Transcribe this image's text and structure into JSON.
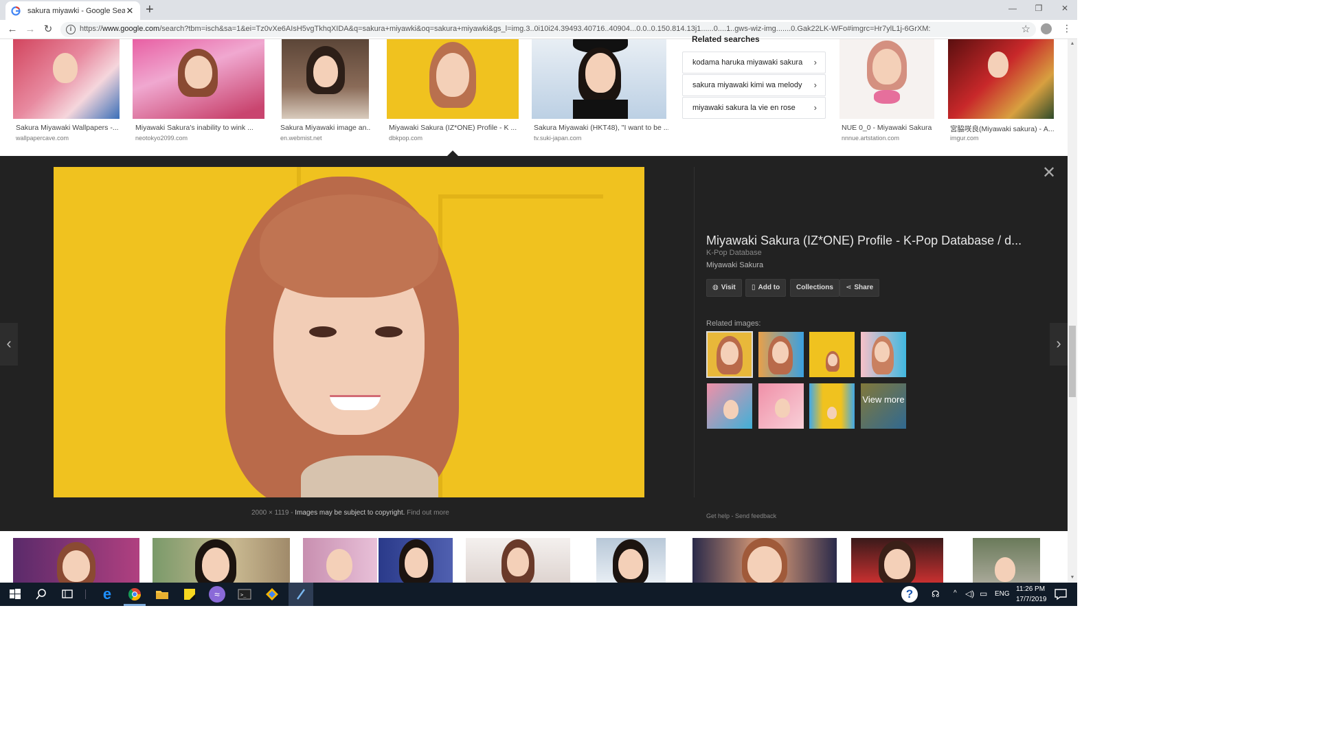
{
  "browser": {
    "tab_title": "sakura miyawki - Google Search",
    "url_prefix": "https://",
    "url_host": "www.google.com",
    "url_rest": "/search?tbm=isch&sa=1&ei=Tz0vXe6AIsH5vgTkhqXIDA&q=sakura+miyawki&oq=sakura+miyawki&gs_l=img.3..0i10i24.39493.40716..40904...0.0..0.150.814.13j1......0....1..gws-wiz-img.......0.Gak22LK-WFo#imgrc=Hr7ylL1j-6GrXM:"
  },
  "results_top": [
    {
      "caption": "Sakura Miyawaki Wallpapers -...",
      "domain": "wallpapercave.com"
    },
    {
      "caption": "Miyawaki Sakura's inability to wink ...",
      "domain": "neotokyo2099.com"
    },
    {
      "caption": "Sakura Miyawaki image an...",
      "domain": "en.webmist.net"
    },
    {
      "caption": "Miyawaki Sakura (IZ*ONE) Profile - K ...",
      "domain": "dbkpop.com"
    },
    {
      "caption": "Sakura Miyawaki (HKT48), \"I want to be ...",
      "domain": "tv.suki-japan.com"
    },
    {
      "caption": "NUE 0_0 - Miyawaki Sakura",
      "domain": "nnnue.artstation.com"
    },
    {
      "caption": "宮脇咲良(Miyawaki sakura) - A...",
      "domain": "imgur.com"
    }
  ],
  "related_searches": {
    "title": "Related searches",
    "items": [
      "kodama haruka miyawaki sakura",
      "sakura miyawaki kimi wa melody",
      "miyawaki sakura la vie en rose"
    ]
  },
  "preview": {
    "title": "Miyawaki Sakura (IZ*ONE) Profile - K-Pop Database / d...",
    "source": "K-Pop Database",
    "subtitle": "Miyawaki Sakura",
    "buttons": {
      "visit": "Visit",
      "add_to": "Add to",
      "collections": "Collections",
      "share": "Share"
    },
    "related_images_label": "Related images:",
    "view_more": "View more",
    "dimensions": "2000 × 1119",
    "copyright_note": "Images may be subject to copyright.",
    "find_out_more": "Find out more",
    "get_help": "Get help",
    "send_feedback": "Send feedback"
  },
  "taskbar": {
    "language": "ENG",
    "time": "11:26 PM",
    "date": "17/7/2019"
  },
  "icons": {
    "back": "arrow-left-icon",
    "forward": "arrow-right-icon",
    "reload": "reload-icon",
    "bookmark": "star-icon",
    "close": "close-icon",
    "prev": "chevron-left-icon",
    "next": "chevron-right-icon"
  },
  "colors": {
    "panel_bg": "#222222",
    "preview_yellow": "#f0c21f",
    "taskbar_bg": "#101b28"
  }
}
